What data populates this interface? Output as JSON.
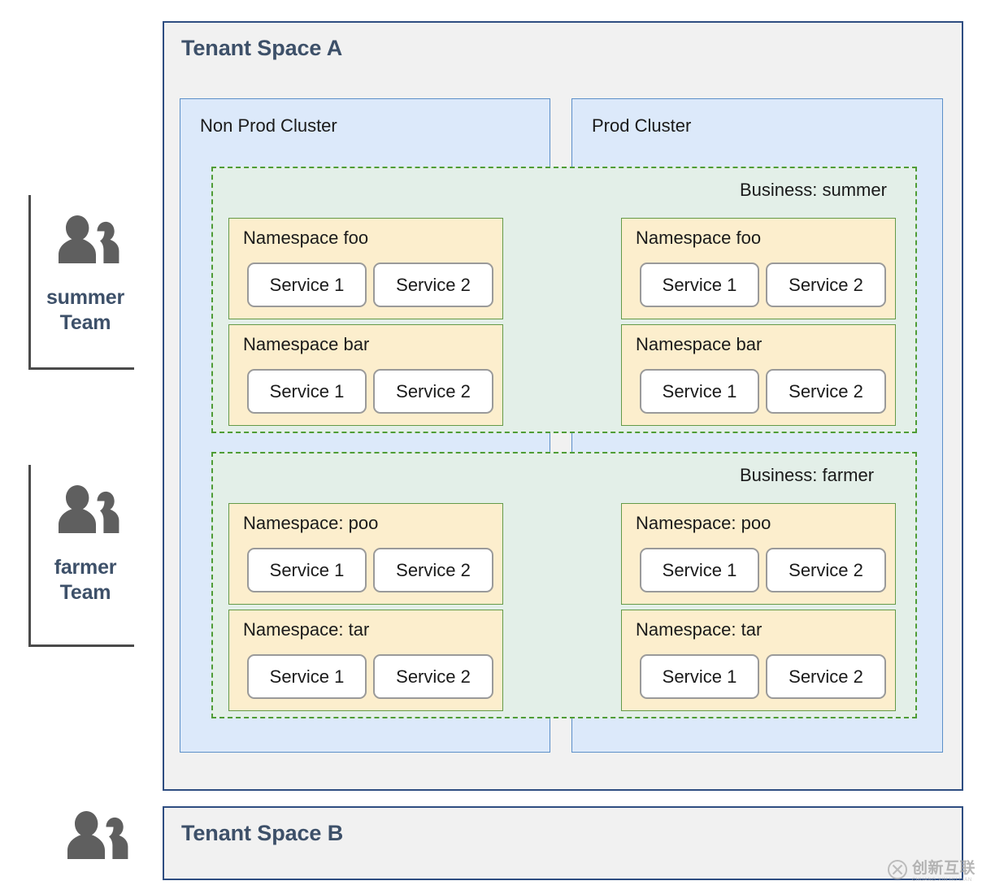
{
  "teams": [
    {
      "name": "summer",
      "suffix": "Team",
      "icon": "people-icon"
    },
    {
      "name": "farmer",
      "suffix": "Team",
      "icon": "people-icon"
    }
  ],
  "tenant_b_icon": "people-icon",
  "tenant_spaces": [
    {
      "title": "Tenant Space A"
    },
    {
      "title": "Tenant Space B"
    }
  ],
  "clusters": [
    {
      "title": "Non Prod Cluster"
    },
    {
      "title": "Prod Cluster"
    }
  ],
  "businesses": [
    {
      "title": "Business: summer",
      "namespaces": [
        {
          "title": "Namespace foo",
          "services": [
            "Service 1",
            "Service 2"
          ]
        },
        {
          "title": "Namespace bar",
          "services": [
            "Service 1",
            "Service 2"
          ]
        }
      ]
    },
    {
      "title": "Business: farmer",
      "namespaces": [
        {
          "title": "Namespace: poo",
          "services": [
            "Service 1",
            "Service 2"
          ]
        },
        {
          "title": "Namespace: tar",
          "services": [
            "Service 1",
            "Service 2"
          ]
        }
      ]
    }
  ],
  "watermark": {
    "main": "创新互联",
    "sub": "CHUANG XIN HU LIAN",
    "icon": "circle-x-logo-icon"
  },
  "colors": {
    "tenant_border": "#2e4d81",
    "tenant_fill": "#f1f1f1",
    "tenant_title": "#3d5069",
    "cluster_fill": "#dce9fa",
    "cluster_border": "#5b8fc9",
    "business_fill": "#e3efe8",
    "business_border": "#4f9c35",
    "namespace_fill": "#fceecd",
    "namespace_border": "#649a48",
    "service_fill": "#ffffff",
    "service_border": "#9a9a9a",
    "icon_gray": "#5f5f5f"
  }
}
